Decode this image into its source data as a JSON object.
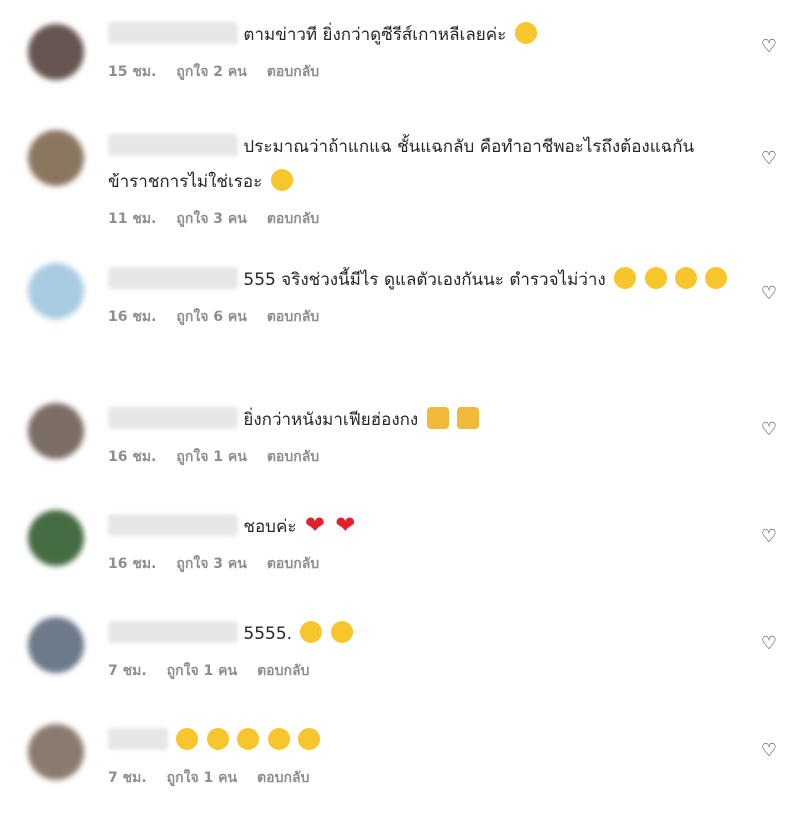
{
  "comments": [
    {
      "text": "ตามข่าวที ยิ่งกว่าดูซีรีส์เกาหลีเลยค่ะ",
      "time": "15 ชม.",
      "likes": "ถูกใจ 2 คน",
      "reply": "ตอบกลับ",
      "emojis": [
        "grin-sweat"
      ]
    },
    {
      "text": "ประมาณว่าถ้าแกแฉ ชั้นแฉกลับ คือทำอาชีพอะไรถึงต้องแฉกัน ข้าราชการไม่ใช่เรอะ",
      "time": "11 ชม.",
      "likes": "ถูกใจ 3 คน",
      "reply": "ตอบกลับ",
      "emojis": [
        "joy"
      ]
    },
    {
      "text": "555 จริงช่วงนี้มีไร ดูแลตัวเองกันนะ ตำรวจไม่ว่าง",
      "time": "16 ชม.",
      "likes": "ถูกใจ 6 คน",
      "reply": "ตอบกลับ",
      "emojis": [
        "joy",
        "joy",
        "joy",
        "joy"
      ]
    },
    {
      "text": "ยิ่งกว่าหนังมาเฟียฮ่องกง",
      "time": "16 ชม.",
      "likes": "ถูกใจ 1 คน",
      "reply": "ตอบกลับ",
      "emojis": [
        "raised-hands",
        "raised-hands"
      ]
    },
    {
      "text": "ชอบค่ะ",
      "time": "16 ชม.",
      "likes": "ถูกใจ 3 คน",
      "reply": "ตอบกลับ",
      "emojis": [
        "heart",
        "heart"
      ]
    },
    {
      "text": "5555.",
      "time": "7 ชม.",
      "likes": "ถูกใจ 1 คน",
      "reply": "ตอบกลับ",
      "emojis": [
        "heart-eyes",
        "heart-eyes"
      ]
    },
    {
      "text": "",
      "time": "7 ชม.",
      "likes": "ถูกใจ 1 คน",
      "reply": "ตอบกลับ",
      "emojis": [
        "joy",
        "joy",
        "joy",
        "joy",
        "joy"
      ]
    }
  ],
  "icons": {
    "like": "heart-outline-icon"
  },
  "colors": {
    "meta": "#8e8e8e",
    "text": "#262626"
  }
}
